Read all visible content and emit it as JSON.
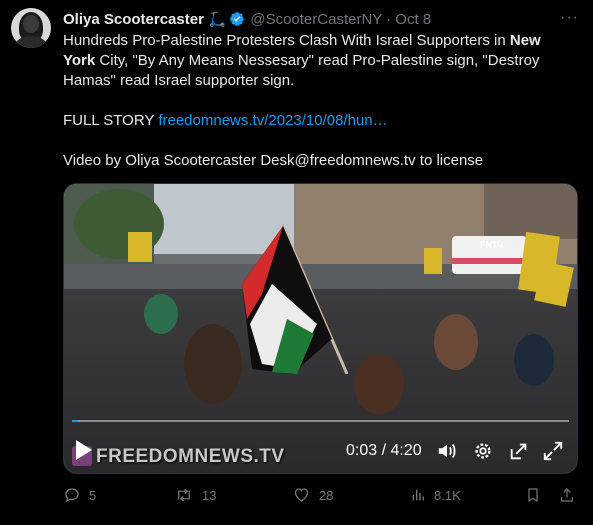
{
  "tweet": {
    "author_name": "Oliya Scootercaster",
    "author_emoji": "🛴",
    "handle": "@ScooterCasterNY",
    "separator": "·",
    "date": "Oct 8",
    "more_label": "···",
    "text_part1": "Hundreds Pro-Palestine Protesters Clash With Israel Supporters in ",
    "text_bold1": "New York",
    "text_part2": " City, \"By Any Means Nessesary\" read Pro-Palestine sign, \"Destroy Hamas\" read Israel supporter sign.",
    "full_story_label": "FULL STORY ",
    "full_story_link": "freedomnews.tv/2023/10/08/hun…",
    "video_credit": "Video by Oliya Scootercaster Desk@freedomnews.tv to license"
  },
  "video": {
    "watermark": "FREEDOMNEWS.TV",
    "channel_bug": "FNTV",
    "time_display": "0:03 / 4:20",
    "progress_fraction": 0.012
  },
  "actions": {
    "replies": "5",
    "reposts": "13",
    "likes": "28",
    "views": "8.1K"
  },
  "colors": {
    "accent": "#1d9bf0",
    "muted": "#71767b",
    "text": "#e7e9ea",
    "background": "#000000"
  }
}
